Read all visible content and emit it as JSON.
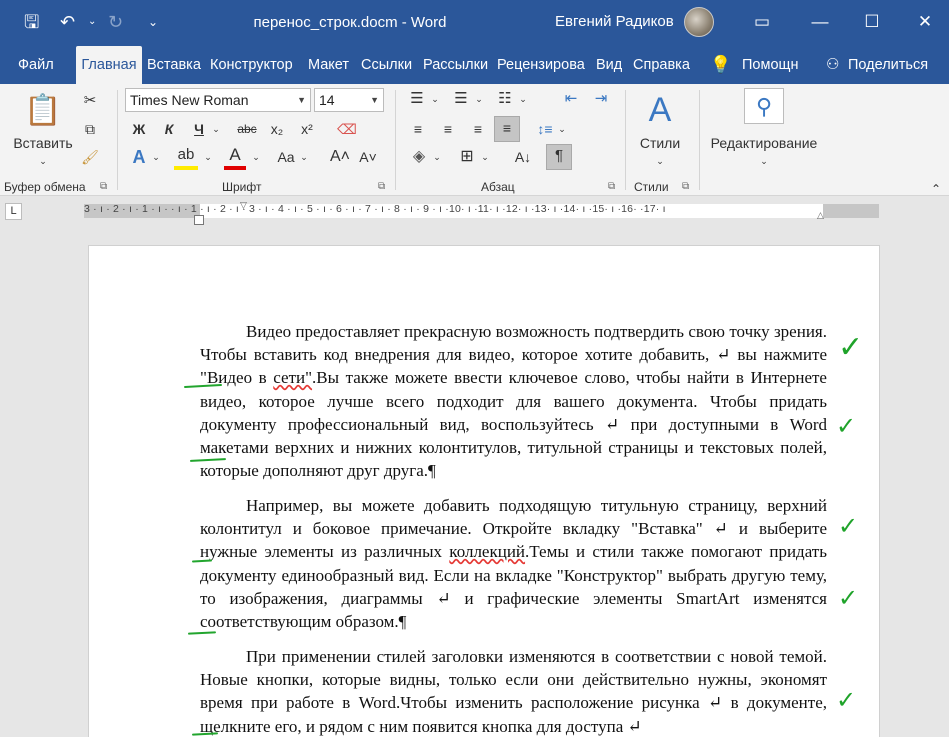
{
  "window": {
    "title": "перенос_строк.docm  -  Word",
    "user": "Евгений Радиков"
  },
  "tabs": [
    "Файл",
    "Главная",
    "Вставка",
    "Конструктор",
    "Макет",
    "Ссылки",
    "Рассылки",
    "Рецензирова",
    "Вид",
    "Справка",
    "Помощн",
    "Поделиться"
  ],
  "ribbon": {
    "paste_label": "Вставить",
    "font_name": "Times New Roman",
    "font_size": "14",
    "bold": "Ж",
    "italic": "К",
    "underline": "Ч",
    "strike": "abc",
    "sub": "x₂",
    "sup": "x²",
    "case": "Aa",
    "grow": "A",
    "styles_label": "Стили",
    "editing_label": "Редактирование",
    "groups": [
      "Буфер обмена",
      "Шрифт",
      "Абзац",
      "Стили"
    ]
  },
  "ruler": {
    "text": "3 · ı · 2 · ı · 1 · ı ·   · ı · 1 · ı · 2 · ı · 3 · ı · 4 · ı · 5 · ı · 6 · ı · 7 · ı · 8 · ı · 9 · ı ·10· ı ·11· ı ·12· ı ·13· ı ·14· ı ·15· ı ·16·   ·17· ı"
  },
  "document": {
    "p1_a": "Видео предоставляет прекрасную возможность подтвердить свою точку зрения. Чтобы вставить код внедрения для видео, которое хотите добавить, ↵ вы нажмите \"Видео в ",
    "p1_b": "сети\"",
    "p1_c": ".Вы также можете ввести ключевое слово, чтобы найти в Интернете видео, которое лучше всего подходит для вашего документа. Чтобы придать документу профессиональный вид, воспользуйтесь ↵ при доступными в Word макетами верхних и нижних колонтитулов, титульной страницы и текстовых полей, которые дополняют друг друга.¶",
    "p2_a": "Например, вы можете добавить подходящую титульную страницу, верхний колонтитул и боковое примечание. Откройте вкладку \"Вставка\" ↵ и выберите нужные элементы из различных ",
    "p2_b": "коллекций",
    "p2_c": ".Темы и стили также помогают придать документу единообразный вид. Если на вкладке \"Конструктор\" выбрать другую тему, то изображения, диаграммы ↵ и графические элементы SmartArt изменятся соответствующим образом.¶",
    "p3": "При применении стилей заголовки изменяются в соответствии с новой темой. Новые кнопки, которые видны, только если они действительно нужны, экономят время при работе в Word.Чтобы изменить расположение рисунка ↵ в документе, щелкните его, и рядом с ним появится кнопка для доступа ↵"
  },
  "colors": {
    "word_blue": "#2b579a",
    "check_green": "#1fa32a"
  }
}
